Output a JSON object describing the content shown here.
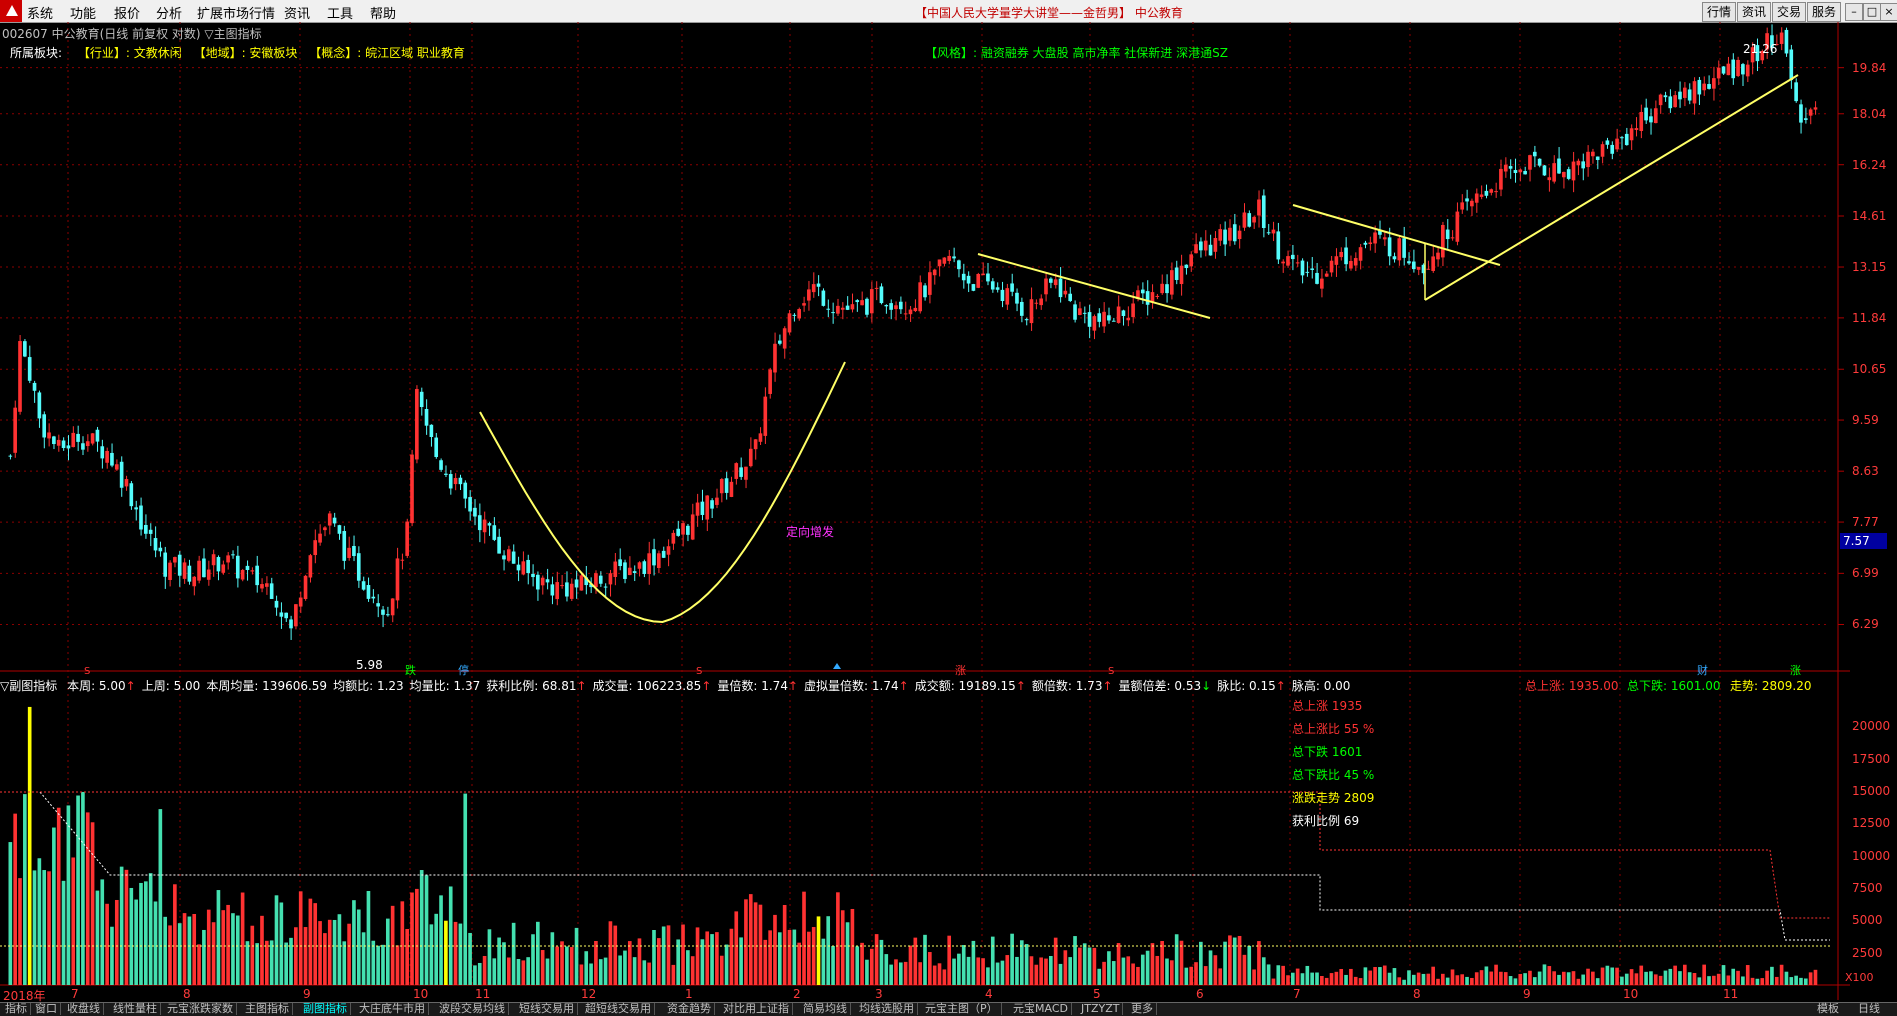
{
  "menu": {
    "items": [
      "系统",
      "功能",
      "报价",
      "分析",
      "扩展市场行情",
      "资讯",
      "工具",
      "帮助"
    ],
    "banner": "【中国人民大学量学大讲堂——金哲男】 中公教育",
    "buttons": [
      "行情",
      "资讯",
      "交易",
      "服务"
    ]
  },
  "stock": {
    "header": "002607 中公教育(日线 前复权 对数) ▽主图指标",
    "sector_line": {
      "label": "所属板块:",
      "industry": "【行业】: 文教休闲",
      "region": "【地域】: 安徽板块",
      "concept": "【概念】: 皖江区域 职业教育"
    },
    "style_line": "【风格】: 融资融券 大盘股 高市净率 社保新进 深港通SZ"
  },
  "colors": {
    "up": "#ff3232",
    "down": "#54fcfc",
    "ma": "#ffff00",
    "background": "#000000",
    "grid": "#8b0000",
    "axis_text": "#ff3b3b"
  },
  "chart_data": [
    {
      "type": "candlestick",
      "title": "002607 中公教育(日线 前复权 对数)",
      "y_scale": "log",
      "ylim": [
        5.75,
        21.8
      ],
      "y_ticks": [
        "19.84",
        "18.04",
        "16.24",
        "14.61",
        "13.15",
        "11.84",
        "10.65",
        "9.59",
        "8.63",
        "7.77",
        "6.99",
        "6.29"
      ],
      "x_months": [
        "2018年",
        "7",
        "8",
        "9",
        "10",
        "11",
        "12",
        "1",
        "2",
        "3",
        "4",
        "5",
        "6",
        "7",
        "8",
        "9",
        "10",
        "11"
      ],
      "annotations": {
        "high_label": "21.26",
        "low_label": "5.98",
        "current_price": "7.57",
        "pattern_text": "定向增发",
        "event_tags": [
          "跌",
          "停",
          "涨",
          "财",
          "涨"
        ],
        "marker_s": "S"
      },
      "price_path": [
        [
          0,
          8.9
        ],
        [
          2,
          11.2
        ],
        [
          4,
          10.6
        ],
        [
          6,
          9.6
        ],
        [
          10,
          9.0
        ],
        [
          14,
          9.3
        ],
        [
          20,
          9.0
        ],
        [
          24,
          8.4
        ],
        [
          28,
          7.6
        ],
        [
          32,
          7.1
        ],
        [
          38,
          7.0
        ],
        [
          44,
          7.2
        ],
        [
          50,
          6.9
        ],
        [
          54,
          6.8
        ],
        [
          58,
          6.2
        ],
        [
          62,
          7.4
        ],
        [
          66,
          7.8
        ],
        [
          70,
          7.2
        ],
        [
          74,
          6.8
        ],
        [
          78,
          6.5
        ],
        [
          82,
          7.6
        ],
        [
          84,
          10.0
        ],
        [
          88,
          8.9
        ],
        [
          94,
          8.1
        ],
        [
          100,
          7.5
        ],
        [
          106,
          7.0
        ],
        [
          112,
          6.8
        ],
        [
          118,
          6.8
        ],
        [
          124,
          7.0
        ],
        [
          130,
          7.1
        ],
        [
          136,
          7.4
        ],
        [
          142,
          7.9
        ],
        [
          148,
          8.4
        ],
        [
          154,
          9.0
        ],
        [
          158,
          11.0
        ],
        [
          162,
          12.2
        ],
        [
          166,
          12.6
        ],
        [
          170,
          12.2
        ],
        [
          174,
          12.0
        ],
        [
          180,
          12.4
        ],
        [
          186,
          12.2
        ],
        [
          190,
          12.7
        ],
        [
          194,
          13.4
        ],
        [
          198,
          12.8
        ],
        [
          204,
          12.6
        ],
        [
          210,
          12.0
        ],
        [
          216,
          12.8
        ],
        [
          220,
          12.0
        ],
        [
          226,
          11.7
        ],
        [
          232,
          12.2
        ],
        [
          238,
          12.6
        ],
        [
          244,
          13.5
        ],
        [
          252,
          14.0
        ],
        [
          258,
          14.8
        ],
        [
          262,
          13.7
        ],
        [
          266,
          13.0
        ],
        [
          270,
          13.0
        ],
        [
          276,
          13.5
        ],
        [
          282,
          13.9
        ],
        [
          288,
          13.6
        ],
        [
          292,
          13.2
        ],
        [
          296,
          14.0
        ],
        [
          302,
          15.0
        ],
        [
          308,
          15.8
        ],
        [
          314,
          16.3
        ],
        [
          320,
          16.0
        ],
        [
          326,
          16.5
        ],
        [
          332,
          17.0
        ],
        [
          338,
          18.0
        ],
        [
          344,
          18.7
        ],
        [
          350,
          19.2
        ],
        [
          356,
          19.8
        ],
        [
          360,
          20.3
        ],
        [
          364,
          21.0
        ],
        [
          367,
          20.8
        ],
        [
          369,
          18.2
        ],
        [
          373,
          18.0
        ]
      ],
      "volume": {
        "ylim": [
          0,
          22500
        ],
        "y_ticks": [
          "20000",
          "17500",
          "15000",
          "12500",
          "10000",
          "7500",
          "5000",
          "2500"
        ],
        "unit": "X100"
      }
    }
  ],
  "sub_indicator": {
    "name": "▽副图指标",
    "items": [
      {
        "label": "本周:",
        "value": "5.00",
        "arrow": "↑"
      },
      {
        "label": "上周:",
        "value": "5.00",
        "arrow": ""
      },
      {
        "label": "本周均量:",
        "value": "139606.59",
        "arrow": ""
      },
      {
        "label": "均额比:",
        "value": "1.23",
        "arrow": ""
      },
      {
        "label": "均量比:",
        "value": "1.37",
        "arrow": ""
      },
      {
        "label": "获利比例:",
        "value": "68.81",
        "arrow": "↑"
      },
      {
        "label": "成交量:",
        "value": "106223.85",
        "arrow": "↑"
      },
      {
        "label": "量倍数:",
        "value": "1.74",
        "arrow": "↑"
      },
      {
        "label": "虚拟量倍数:",
        "value": "1.74",
        "arrow": "↑"
      },
      {
        "label": "成交额:",
        "value": "19189.15",
        "arrow": "↑"
      },
      {
        "label": "额倍数:",
        "value": "1.73",
        "arrow": "↑"
      },
      {
        "label": "量额倍差:",
        "value": "0.53",
        "arrow": "↓"
      },
      {
        "label": "脉比:",
        "value": "0.15",
        "arrow": "↑"
      },
      {
        "label": "脉高:",
        "value": "0.00",
        "arrow": ""
      }
    ],
    "right": {
      "total_up": "总上涨: 1935.00",
      "total_down": "总下跌: 1601.00",
      "trend": "走势: 2809.20"
    },
    "legend": [
      {
        "text": "总上涨 1935",
        "color": "#ff3333"
      },
      {
        "text": "总上涨比 55 %",
        "color": "#ff3333"
      },
      {
        "text": "总下跌 1601",
        "color": "#00ff00"
      },
      {
        "text": "总下跌比 45 %",
        "color": "#00ff00"
      },
      {
        "text": "涨跌走势 2809",
        "color": "#ffff00"
      },
      {
        "text": "获利比例 69",
        "color": "#ffffff"
      }
    ]
  },
  "tabs": [
    "指标",
    "窗口",
    "收盘线",
    "线性量柱",
    "元宝涨跌家数",
    "主图指标",
    "副图指标",
    "大庄底牛市用",
    "波段交易均线",
    "短线交易用",
    "超短线交易用",
    "资金趋势",
    "对比用上证指",
    "简易均线",
    "均线选股用",
    "元宝主图（P）",
    "元宝MACD",
    "JTZYZT",
    "更多"
  ],
  "active_tab": "副图指标",
  "bottom_right": {
    "template": "模板",
    "period": "日线"
  }
}
